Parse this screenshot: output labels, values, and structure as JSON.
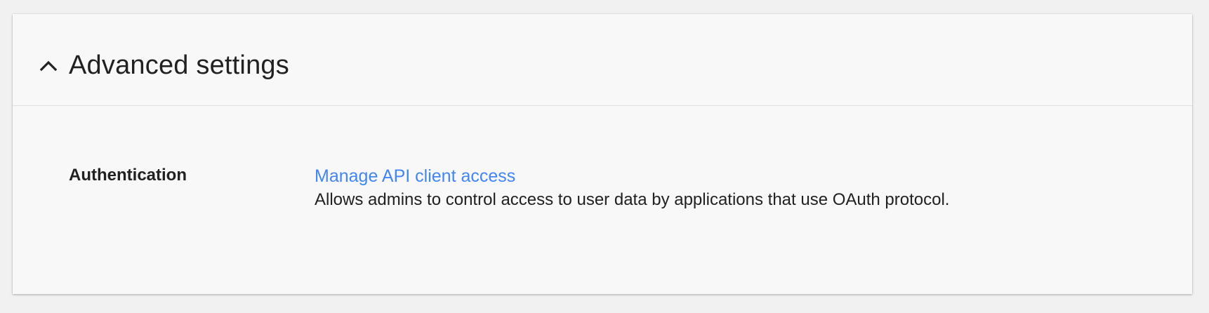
{
  "section": {
    "title": "Advanced settings",
    "expanded": true,
    "icon": "chevron-up-icon"
  },
  "authentication": {
    "label": "Authentication",
    "link_text": "Manage API client access",
    "description": "Allows admins to control access to user data by applications that use OAuth protocol."
  },
  "colors": {
    "link": "#4285f4",
    "text": "#212121",
    "card_bg": "#f8f8f8",
    "page_bg": "#f1f1f1"
  }
}
